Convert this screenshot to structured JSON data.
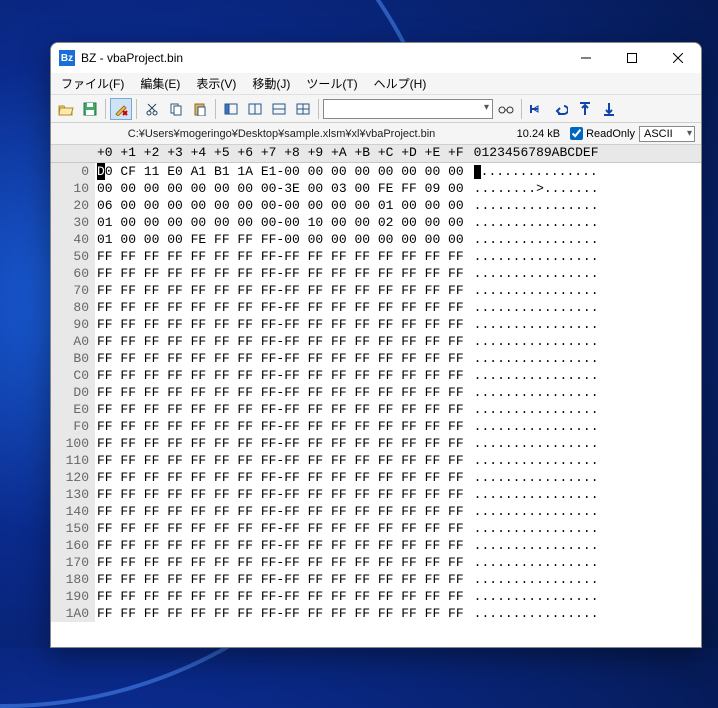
{
  "window": {
    "app_icon_text": "Bz",
    "title": "BZ - vbaProject.bin"
  },
  "menu": {
    "file": "ファイル(F)",
    "edit": "編集(E)",
    "view": "表示(V)",
    "move": "移動(J)",
    "tool": "ツール(T)",
    "help": "ヘルプ(H)"
  },
  "toolbar": {
    "search_value": ""
  },
  "pathbar": {
    "path": "C:¥Users¥mogeringo¥Desktop¥sample.xlsm¥xl¥vbaProject.bin",
    "size": "10.24 kB",
    "readonly_label": "ReadOnly",
    "readonly_checked": true,
    "encoding": "ASCII"
  },
  "hex": {
    "col_header": "+0 +1 +2 +3 +4 +5 +6 +7 +8 +9 +A +B +C +D +E +F",
    "ascii_header": "0123456789ABCDEF",
    "rows": [
      {
        "ofs": "0",
        "b": "D0 CF 11 E0 A1 B1 1A E1-00 00 00 00 00 00 00 00",
        "a": " ..............."
      },
      {
        "ofs": "10",
        "b": "00 00 00 00 00 00 00 00-3E 00 03 00 FE FF 09 00",
        "a": "........>......."
      },
      {
        "ofs": "20",
        "b": "06 00 00 00 00 00 00 00-00 00 00 00 01 00 00 00",
        "a": "................"
      },
      {
        "ofs": "30",
        "b": "01 00 00 00 00 00 00 00-00 10 00 00 02 00 00 00",
        "a": "................"
      },
      {
        "ofs": "40",
        "b": "01 00 00 00 FE FF FF FF-00 00 00 00 00 00 00 00",
        "a": "................"
      },
      {
        "ofs": "50",
        "b": "FF FF FF FF FF FF FF FF-FF FF FF FF FF FF FF FF",
        "a": "................"
      },
      {
        "ofs": "60",
        "b": "FF FF FF FF FF FF FF FF-FF FF FF FF FF FF FF FF",
        "a": "................"
      },
      {
        "ofs": "70",
        "b": "FF FF FF FF FF FF FF FF-FF FF FF FF FF FF FF FF",
        "a": "................"
      },
      {
        "ofs": "80",
        "b": "FF FF FF FF FF FF FF FF-FF FF FF FF FF FF FF FF",
        "a": "................"
      },
      {
        "ofs": "90",
        "b": "FF FF FF FF FF FF FF FF-FF FF FF FF FF FF FF FF",
        "a": "................"
      },
      {
        "ofs": "A0",
        "b": "FF FF FF FF FF FF FF FF-FF FF FF FF FF FF FF FF",
        "a": "................"
      },
      {
        "ofs": "B0",
        "b": "FF FF FF FF FF FF FF FF-FF FF FF FF FF FF FF FF",
        "a": "................"
      },
      {
        "ofs": "C0",
        "b": "FF FF FF FF FF FF FF FF-FF FF FF FF FF FF FF FF",
        "a": "................"
      },
      {
        "ofs": "D0",
        "b": "FF FF FF FF FF FF FF FF-FF FF FF FF FF FF FF FF",
        "a": "................"
      },
      {
        "ofs": "E0",
        "b": "FF FF FF FF FF FF FF FF-FF FF FF FF FF FF FF FF",
        "a": "................"
      },
      {
        "ofs": "F0",
        "b": "FF FF FF FF FF FF FF FF-FF FF FF FF FF FF FF FF",
        "a": "................"
      },
      {
        "ofs": "100",
        "b": "FF FF FF FF FF FF FF FF-FF FF FF FF FF FF FF FF",
        "a": "................"
      },
      {
        "ofs": "110",
        "b": "FF FF FF FF FF FF FF FF-FF FF FF FF FF FF FF FF",
        "a": "................"
      },
      {
        "ofs": "120",
        "b": "FF FF FF FF FF FF FF FF-FF FF FF FF FF FF FF FF",
        "a": "................"
      },
      {
        "ofs": "130",
        "b": "FF FF FF FF FF FF FF FF-FF FF FF FF FF FF FF FF",
        "a": "................"
      },
      {
        "ofs": "140",
        "b": "FF FF FF FF FF FF FF FF-FF FF FF FF FF FF FF FF",
        "a": "................"
      },
      {
        "ofs": "150",
        "b": "FF FF FF FF FF FF FF FF-FF FF FF FF FF FF FF FF",
        "a": "................"
      },
      {
        "ofs": "160",
        "b": "FF FF FF FF FF FF FF FF-FF FF FF FF FF FF FF FF",
        "a": "................"
      },
      {
        "ofs": "170",
        "b": "FF FF FF FF FF FF FF FF-FF FF FF FF FF FF FF FF",
        "a": "................"
      },
      {
        "ofs": "180",
        "b": "FF FF FF FF FF FF FF FF-FF FF FF FF FF FF FF FF",
        "a": "................"
      },
      {
        "ofs": "190",
        "b": "FF FF FF FF FF FF FF FF-FF FF FF FF FF FF FF FF",
        "a": "................"
      },
      {
        "ofs": "1A0",
        "b": "FF FF FF FF FF FF FF FF-FF FF FF FF FF FF FF FF",
        "a": "................"
      }
    ]
  }
}
